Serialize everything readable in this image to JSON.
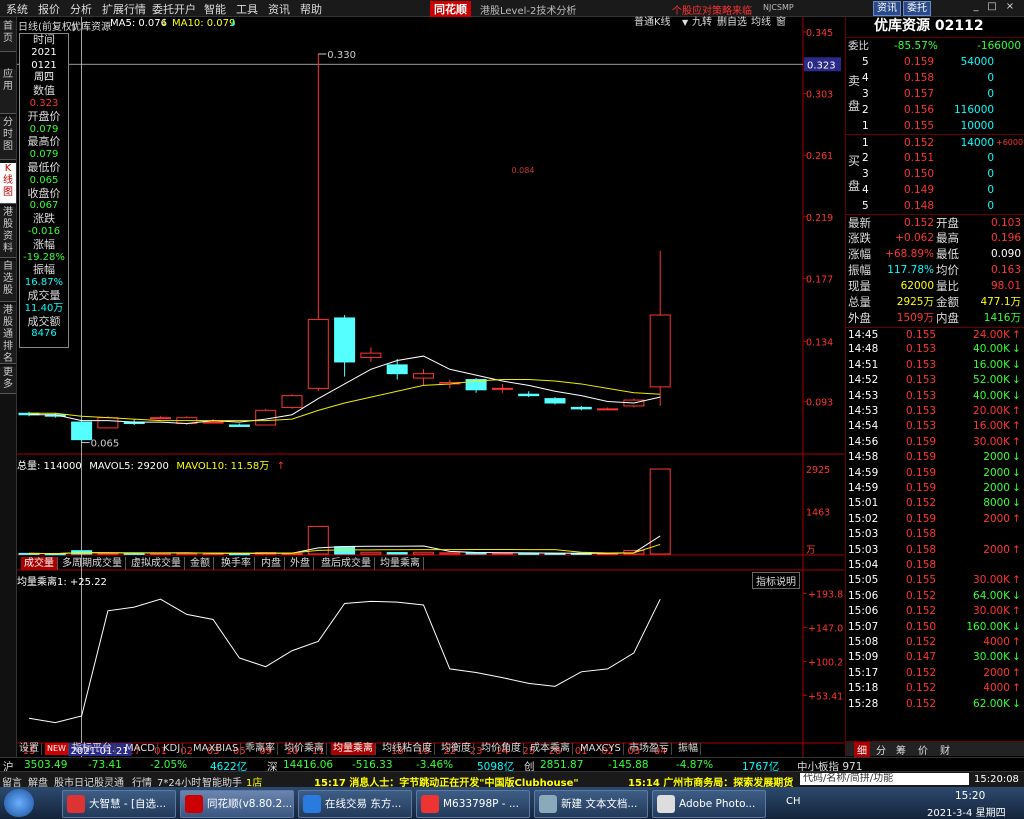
{
  "menu": {
    "items": [
      "系统",
      "报价",
      "分析",
      "扩展行情",
      "委托开户",
      "智能",
      "工具",
      "资讯",
      "帮助"
    ],
    "logo": "同花顺",
    "product": "港股Level-2技术分析",
    "ad": "个股应对策略来临",
    "ad_code": "NJCSMP",
    "btn_news": "资讯",
    "btn_trade": "委托",
    "win_min": "_",
    "win_max": "□",
    "win_close": "×"
  },
  "vtabs": [
    "首页",
    "应用",
    "分时图",
    "K线图",
    "港股资料",
    "自选股",
    "港股通排名",
    "更多"
  ],
  "chart": {
    "period": "日线(前复权)",
    "stock_name": "优库资源",
    "ma5": "MA5: 0.076",
    "ma10": "MA10: 0.079",
    "arrow": "↓",
    "buttons": [
      "普通K线",
      "九转",
      "删自选",
      "均线",
      "窗"
    ],
    "y_labels": [
      "0.345",
      "0.303",
      "0.261",
      "0.219",
      "0.177",
      "0.134",
      "0.093"
    ],
    "current_price": "0.323",
    "high_mark": "0.330",
    "low_mark": "0.065",
    "mid_label": "0.084",
    "cursor_date": "2021-01-21",
    "x_labels": [
      "15",
      "18",
      "21",
      "26",
      "27",
      "01",
      "02",
      "03",
      "05",
      "09",
      "10",
      "11",
      "16",
      "17",
      "18",
      "19",
      "22",
      "23",
      "24",
      "25",
      "26",
      "01",
      "02",
      "03",
      "04"
    ]
  },
  "info": [
    {
      "label": "时间",
      "value": "2021"
    },
    {
      "label": "",
      "value": "0121"
    },
    {
      "label": "",
      "value": "周四"
    },
    {
      "label": "数值",
      "value": "0.323"
    },
    {
      "label": "开盘价",
      "value": "0.079"
    },
    {
      "label": "最高价",
      "value": "0.079"
    },
    {
      "label": "最低价",
      "value": "0.065"
    },
    {
      "label": "收盘价",
      "value": "0.067"
    },
    {
      "label": "涨跌",
      "value": "-0.016"
    },
    {
      "label": "涨幅",
      "value": "-19.28%"
    },
    {
      "label": "振幅",
      "value": "16.87%"
    },
    {
      "label": "成交量",
      "value": "11.40万"
    },
    {
      "label": "成交额",
      "value": "8476"
    }
  ],
  "volume": {
    "total": "总量: 114000",
    "mavol5": "MAVOL5: 29200",
    "mavol10": "MAVOL10: 11.58万",
    "arrow": "↑",
    "y_labels": [
      "2925",
      "1463"
    ],
    "unit": "万"
  },
  "indicator_tabs": [
    "成交量",
    "多周期成交量",
    "虚拟成交量",
    "金额",
    "换手率",
    "内盘",
    "外盘",
    "盘后成交量",
    "均量乘离"
  ],
  "indicator": {
    "title": "均量乘离1: +25.22",
    "help": "指标说明",
    "y_labels": [
      "+193.8",
      "+147.0",
      "+100.2",
      "+53.41"
    ]
  },
  "bottom_tabs": [
    "设置",
    "NEW",
    "指标平台",
    "MACD",
    "KDJ",
    "MAXBIAS",
    "乖离率",
    "均价乘离",
    "均量乘离",
    "均线粘合度",
    "均衡度",
    "均价角度",
    "成本乘离",
    "MAXCYS",
    "市场盈亏",
    "振幅"
  ],
  "quote": {
    "title": "优库资源 02112",
    "weibi_label": "委比",
    "weibi": "-85.57%",
    "weicha": "-166000",
    "sell_label": [
      "卖",
      "盘"
    ],
    "buy_label": [
      "买",
      "盘"
    ],
    "sells": [
      {
        "n": "5",
        "p": "0.159",
        "v": "54000"
      },
      {
        "n": "4",
        "p": "0.158",
        "v": "0"
      },
      {
        "n": "3",
        "p": "0.157",
        "v": "0"
      },
      {
        "n": "2",
        "p": "0.156",
        "v": "116000"
      },
      {
        "n": "1",
        "p": "0.155",
        "v": "10000"
      }
    ],
    "buys": [
      {
        "n": "1",
        "p": "0.152",
        "v": "14000",
        "d": "+6000"
      },
      {
        "n": "2",
        "p": "0.151",
        "v": "0",
        "d": ""
      },
      {
        "n": "3",
        "p": "0.150",
        "v": "0",
        "d": ""
      },
      {
        "n": "4",
        "p": "0.149",
        "v": "0",
        "d": ""
      },
      {
        "n": "5",
        "p": "0.148",
        "v": "0",
        "d": ""
      }
    ],
    "stats": [
      [
        "最新",
        "0.152",
        "开盘",
        "0.103"
      ],
      [
        "涨跌",
        "+0.062",
        "最高",
        "0.196"
      ],
      [
        "涨幅",
        "+68.89%",
        "最低",
        "0.090"
      ],
      [
        "振幅",
        "117.78%",
        "均价",
        "0.163"
      ],
      [
        "现量",
        "62000",
        "量比",
        "98.01"
      ],
      [
        "总量",
        "2925万",
        "金额",
        "477.1万"
      ],
      [
        "外盘",
        "1509万",
        "内盘",
        "1416万"
      ]
    ],
    "ticks": [
      [
        "14:45",
        "0.155",
        "24.00K",
        "up"
      ],
      [
        "14:48",
        "0.153",
        "40.00K",
        "down"
      ],
      [
        "14:51",
        "0.153",
        "16.00K",
        "down"
      ],
      [
        "14:52",
        "0.153",
        "52.00K",
        "down"
      ],
      [
        "14:53",
        "0.153",
        "40.00K",
        "down"
      ],
      [
        "14:53",
        "0.153",
        "20.00K",
        "up"
      ],
      [
        "14:54",
        "0.153",
        "16.00K",
        "up"
      ],
      [
        "14:56",
        "0.159",
        "30.00K",
        "up"
      ],
      [
        "14:58",
        "0.159",
        "2000",
        "down"
      ],
      [
        "14:59",
        "0.159",
        "2000",
        "down"
      ],
      [
        "14:59",
        "0.159",
        "2000",
        "down"
      ],
      [
        "15:01",
        "0.152",
        "8000",
        "down"
      ],
      [
        "15:02",
        "0.159",
        "2000",
        "up"
      ],
      [
        "15:03",
        "0.158",
        "",
        ""
      ],
      [
        "15:03",
        "0.158",
        "2000",
        "up"
      ],
      [
        "15:04",
        "0.158",
        "",
        ""
      ],
      [
        "15:05",
        "0.155",
        "30.00K",
        "up"
      ],
      [
        "15:06",
        "0.152",
        "64.00K",
        "down"
      ],
      [
        "15:06",
        "0.152",
        "30.00K",
        "up"
      ],
      [
        "15:07",
        "0.150",
        "160.00K",
        "down"
      ],
      [
        "15:08",
        "0.152",
        "4000",
        "up"
      ],
      [
        "15:09",
        "0.147",
        "30.00K",
        "down"
      ],
      [
        "15:17",
        "0.152",
        "2000",
        "up"
      ],
      [
        "15:18",
        "0.152",
        "4000",
        "up"
      ],
      [
        "15:28",
        "0.152",
        "62.00K",
        "down"
      ]
    ],
    "bottom_tabs": [
      "细",
      "分",
      "筹",
      "价",
      "财"
    ]
  },
  "index_bar": {
    "sh_label": "沪",
    "sh": "3503.49",
    "sh_chg": "-73.41",
    "sh_pct": "-2.05%",
    "sh_amt": "4622亿",
    "sz_label": "深",
    "sz": "14416.06",
    "sz_chg": "-516.33",
    "sz_pct": "-3.46%",
    "sz_amt": "5098亿",
    "cy_label": "创",
    "cy": "2851.87",
    "cy_chg": "-145.88",
    "cy_pct": "-4.87%",
    "cy_amt": "1767亿",
    "zxb": "中小板指 971"
  },
  "news_bar": {
    "items": [
      "留言",
      "解盘",
      "股市日记",
      "股灵通",
      "行情",
      "7*24小时",
      "智能助手"
    ],
    "tag": "1店",
    "news1": "15:17 消息人士：字节跳动正在开发\"中国版Clubhouse\"",
    "news2": "15:14 广州市商务局：探索发展期货",
    "search": "代码/名称/简拼/功能",
    "clock": "15:20:08"
  },
  "taskbar": {
    "tasks": [
      "大智慧 - [自选...",
      "同花顺(v8.80.2...",
      "在线交易 东方...",
      "M633798P - ...",
      "新建 文本文档...",
      "Adobe Photo..."
    ],
    "lang": "CH",
    "time": "15:20",
    "date": "2021-3-4 星期四"
  },
  "chart_data": {
    "type": "candlestick",
    "x": [
      "15",
      "18",
      "21",
      "26",
      "27",
      "01",
      "02",
      "03",
      "05",
      "09",
      "10",
      "11",
      "16",
      "17",
      "18",
      "19",
      "22",
      "23",
      "24",
      "25",
      "26",
      "01",
      "02",
      "03",
      "04"
    ],
    "ohlc": [
      [
        0.085,
        0.086,
        0.083,
        0.084
      ],
      [
        0.084,
        0.085,
        0.082,
        0.083
      ],
      [
        0.079,
        0.079,
        0.065,
        0.067
      ],
      [
        0.075,
        0.083,
        0.075,
        0.082
      ],
      [
        0.079,
        0.081,
        0.077,
        0.078
      ],
      [
        0.082,
        0.083,
        0.081,
        0.082
      ],
      [
        0.078,
        0.083,
        0.077,
        0.082
      ],
      [
        0.079,
        0.081,
        0.078,
        0.079
      ],
      [
        0.077,
        0.078,
        0.076,
        0.076
      ],
      [
        0.077,
        0.088,
        0.077,
        0.087
      ],
      [
        0.089,
        0.098,
        0.088,
        0.097
      ],
      [
        0.102,
        0.33,
        0.1,
        0.149
      ],
      [
        0.15,
        0.152,
        0.11,
        0.12
      ],
      [
        0.123,
        0.13,
        0.12,
        0.126
      ],
      [
        0.118,
        0.122,
        0.108,
        0.112
      ],
      [
        0.109,
        0.115,
        0.104,
        0.112
      ],
      [
        0.105,
        0.108,
        0.102,
        0.106
      ],
      [
        0.108,
        0.109,
        0.099,
        0.101
      ],
      [
        0.102,
        0.105,
        0.099,
        0.102
      ],
      [
        0.098,
        0.1,
        0.096,
        0.097
      ],
      [
        0.095,
        0.096,
        0.091,
        0.092
      ],
      [
        0.089,
        0.09,
        0.087,
        0.088
      ],
      [
        0.088,
        0.089,
        0.087,
        0.088
      ],
      [
        0.09,
        0.095,
        0.089,
        0.094
      ],
      [
        0.103,
        0.196,
        0.09,
        0.152
      ]
    ],
    "ma5": [
      0.084,
      0.084,
      0.08,
      0.08,
      0.079,
      0.079,
      0.078,
      0.08,
      0.079,
      0.081,
      0.084,
      0.095,
      0.105,
      0.115,
      0.121,
      0.124,
      0.115,
      0.111,
      0.107,
      0.104,
      0.1,
      0.097,
      0.093,
      0.092,
      0.096
    ],
    "ma10": [
      0.085,
      0.085,
      0.083,
      0.082,
      0.081,
      0.08,
      0.08,
      0.08,
      0.08,
      0.08,
      0.081,
      0.087,
      0.092,
      0.096,
      0.1,
      0.104,
      0.105,
      0.107,
      0.108,
      0.108,
      0.107,
      0.105,
      0.102,
      0.099,
      0.098
    ],
    "volume": [
      2,
      1,
      11.4,
      3,
      2,
      2,
      3,
      2,
      1,
      5,
      2,
      95,
      25,
      6,
      5,
      6,
      4,
      4,
      3,
      2,
      2,
      2,
      2,
      12,
      292.5
    ],
    "bias": [
      22,
      16,
      25.2,
      170,
      175,
      186,
      165,
      158,
      105,
      93,
      115,
      128,
      180,
      183,
      182,
      178,
      90,
      85,
      78,
      70,
      66,
      86,
      90,
      112,
      186
    ],
    "ylim": [
      0.062,
      0.345
    ],
    "bias_ylim": [
      10,
      200
    ]
  }
}
